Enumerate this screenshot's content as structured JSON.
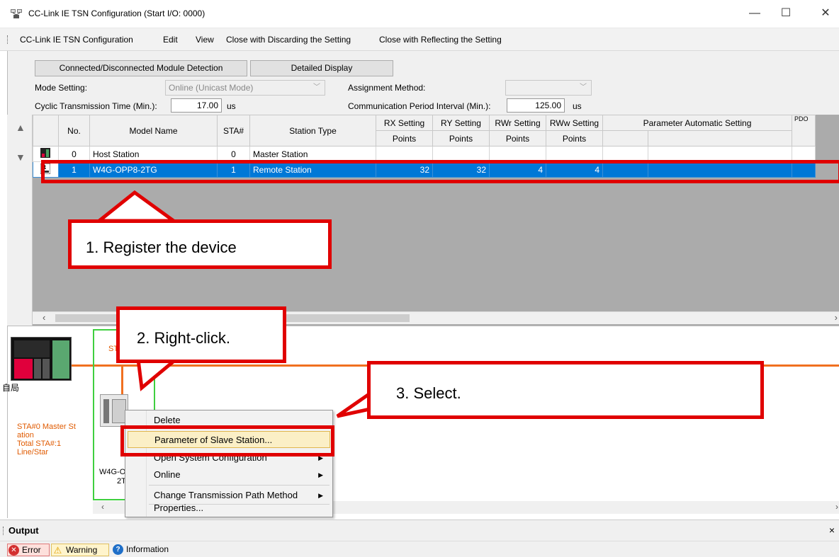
{
  "window": {
    "title": "CC-Link IE TSN Configuration (Start I/O: 0000)",
    "minimize": "—",
    "maximize": "☐",
    "close": "✕"
  },
  "menu": [
    "CC-Link IE TSN Configuration",
    "Edit",
    "View",
    "Close with Discarding the Setting",
    "Close with Reflecting the Setting"
  ],
  "toolbar": {
    "detect_button": "Connected/Disconnected Module Detection",
    "detail_button": "Detailed Display",
    "mode_label": "Mode Setting:",
    "mode_value": "Online (Unicast Mode)",
    "assign_label": "Assignment Method:",
    "cyclic_label": "Cyclic Transmission Time (Min.):",
    "cyclic_value": "17.00",
    "cyclic_unit": "us",
    "period_label": "Communication Period Interval (Min.):",
    "period_value": "125.00",
    "period_unit": "us"
  },
  "grid": {
    "headers": {
      "no": "No.",
      "model": "Model Name",
      "sta": "STA#",
      "type": "Station Type",
      "rx": "RX Setting",
      "ry": "RY Setting",
      "rwr": "RWr Setting",
      "rww": "RWw Setting",
      "points": "Points",
      "param": "Parameter Automatic Setting",
      "pdo": "PDO"
    },
    "rows": [
      {
        "no": "0",
        "model": "Host Station",
        "sta": "0",
        "type": "Master Station",
        "rx": "",
        "ry": "",
        "rwr": "",
        "rww": ""
      },
      {
        "no": "1",
        "model": "W4G-OPP8-2TG",
        "sta": "1",
        "type": "Remote Station",
        "rx": "32",
        "ry": "32",
        "rwr": "4",
        "rww": "4"
      }
    ]
  },
  "diagram": {
    "host_label": "自局",
    "master_info": [
      "STA#0  Master St",
      "ation",
      "Total STA#:1",
      "Line/Star"
    ],
    "device_label_1": "W4G-O",
    "device_label_2": "2T",
    "sta_prefix": "ST"
  },
  "context_menu": [
    {
      "label": "Delete",
      "submenu": false
    },
    {
      "label": "Parameter of Slave Station...",
      "submenu": false,
      "highlighted": true
    },
    {
      "label": "Open System Configuration",
      "submenu": true
    },
    {
      "label": "Online",
      "submenu": true
    },
    {
      "label": "Change Transmission Path Method",
      "submenu": true
    },
    {
      "label": "Properties...",
      "submenu": false
    }
  ],
  "output": {
    "title": "Output",
    "close": "×",
    "tabs": [
      "Error",
      "Warning",
      "Information"
    ]
  },
  "callouts": {
    "step1": "1. Register the device",
    "step2": "2. Right-click.",
    "step3": "3. Select."
  },
  "colors": {
    "selection": "#0078d7",
    "annotation_red": "#e00000",
    "network_line": "#f07020",
    "menu_highlight": "#fbefc6"
  }
}
